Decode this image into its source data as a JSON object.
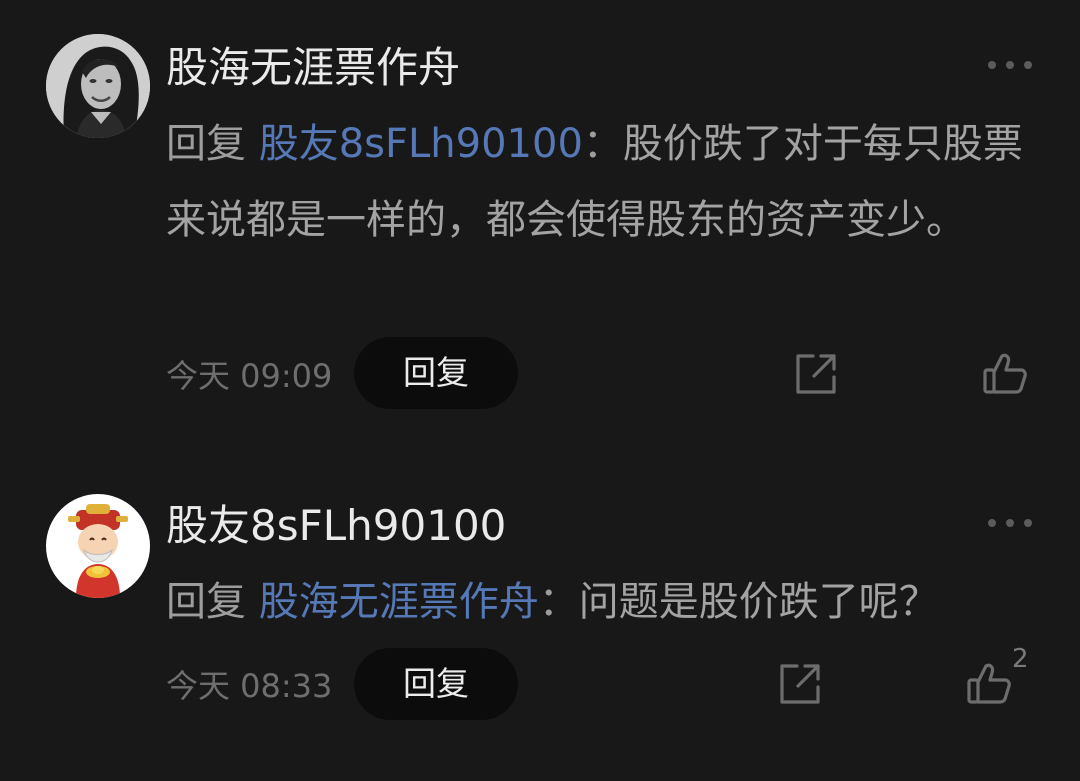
{
  "comments": [
    {
      "username": "股海无涯票作舟",
      "reply_prefix": "回复 ",
      "mention": "股友8sFLh90100",
      "separator": "：",
      "content": "股价跌了对于每只股票来说都是一样的，都会使得股东的资产变少。",
      "time": "今天 09:09",
      "reply_label": "回复",
      "like_count": "",
      "avatar_icon": "grayscale-woman-portrait-avatar",
      "share_icon": "share-icon",
      "like_icon": "thumbs-up-icon",
      "more_icon": "more-dots-icon"
    },
    {
      "username": "股友8sFLh90100",
      "reply_prefix": "回复 ",
      "mention": "股海无涯票作舟",
      "separator": "：",
      "content": "问题是股价跌了呢？",
      "time": "今天 08:33",
      "reply_label": "回复",
      "like_count": "2",
      "avatar_icon": "fortune-god-cartoon-avatar",
      "share_icon": "share-icon",
      "like_icon": "thumbs-up-icon",
      "more_icon": "more-dots-icon"
    }
  ],
  "colors": {
    "background": "#181818",
    "mention": "#5678b6",
    "body_text": "#a3a3a3",
    "username": "#eaeaea",
    "reply_button_bg": "#0c0c0c",
    "icon": "#6d6d6d"
  }
}
